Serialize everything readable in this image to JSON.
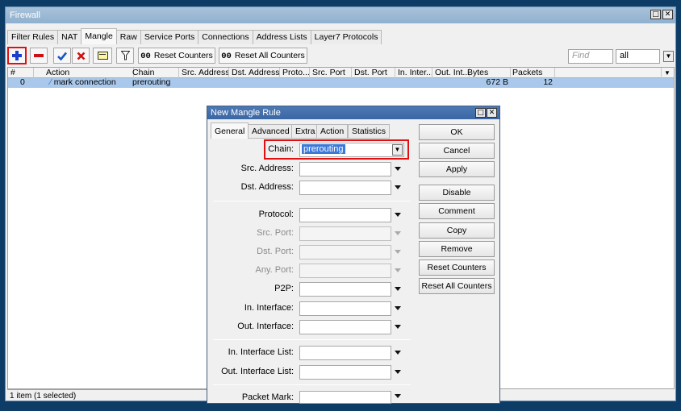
{
  "window": {
    "title": "Firewall"
  },
  "tabs": [
    "Filter Rules",
    "NAT",
    "Mangle",
    "Raw",
    "Service Ports",
    "Connections",
    "Address Lists",
    "Layer7 Protocols"
  ],
  "toolbar": {
    "reset_counters": {
      "prefix": "00",
      "label": "Reset Counters"
    },
    "reset_all_counters": {
      "prefix": "00",
      "label": "Reset All Counters"
    },
    "find_placeholder": "Find",
    "filter_value": "all",
    "colors": {
      "add": "#1a3fcc",
      "remove": "#cc1111",
      "enable": "#1a55c8",
      "disable": "#cc1111",
      "highlight": "#e01010"
    }
  },
  "table": {
    "columns": [
      "#",
      "Action",
      "Chain",
      "Src. Address",
      "Dst. Address",
      "Proto...",
      "Src. Port",
      "Dst. Port",
      "In. Inter...",
      "Out. Int...",
      "Bytes",
      "Packets"
    ],
    "rows": [
      {
        "num": "0",
        "action": "mark connection",
        "chain": "prerouting",
        "bytes": "672 B",
        "packets": "12"
      }
    ],
    "selected_row_color": "#a9c8ec"
  },
  "status": "1 item (1 selected)",
  "dialog": {
    "title": "New Mangle Rule",
    "tabs": [
      "General",
      "Advanced",
      "Extra",
      "Action",
      "Statistics"
    ],
    "fields": {
      "chain_label": "Chain:",
      "chain_value": "prerouting",
      "src_address": "Src. Address:",
      "dst_address": "Dst. Address:",
      "protocol": "Protocol:",
      "src_port": "Src. Port:",
      "dst_port": "Dst. Port:",
      "any_port": "Any. Port:",
      "p2p": "P2P:",
      "in_interface": "In. Interface:",
      "out_interface": "Out. Interface:",
      "in_interface_list": "In. Interface List:",
      "out_interface_list": "Out. Interface List:",
      "packet_mark": "Packet Mark:"
    },
    "buttons": {
      "ok": "OK",
      "cancel": "Cancel",
      "apply": "Apply",
      "disable": "Disable",
      "comment": "Comment",
      "copy": "Copy",
      "remove": "Remove",
      "reset_counters": "Reset Counters",
      "reset_all_counters": "Reset All Counters"
    }
  }
}
